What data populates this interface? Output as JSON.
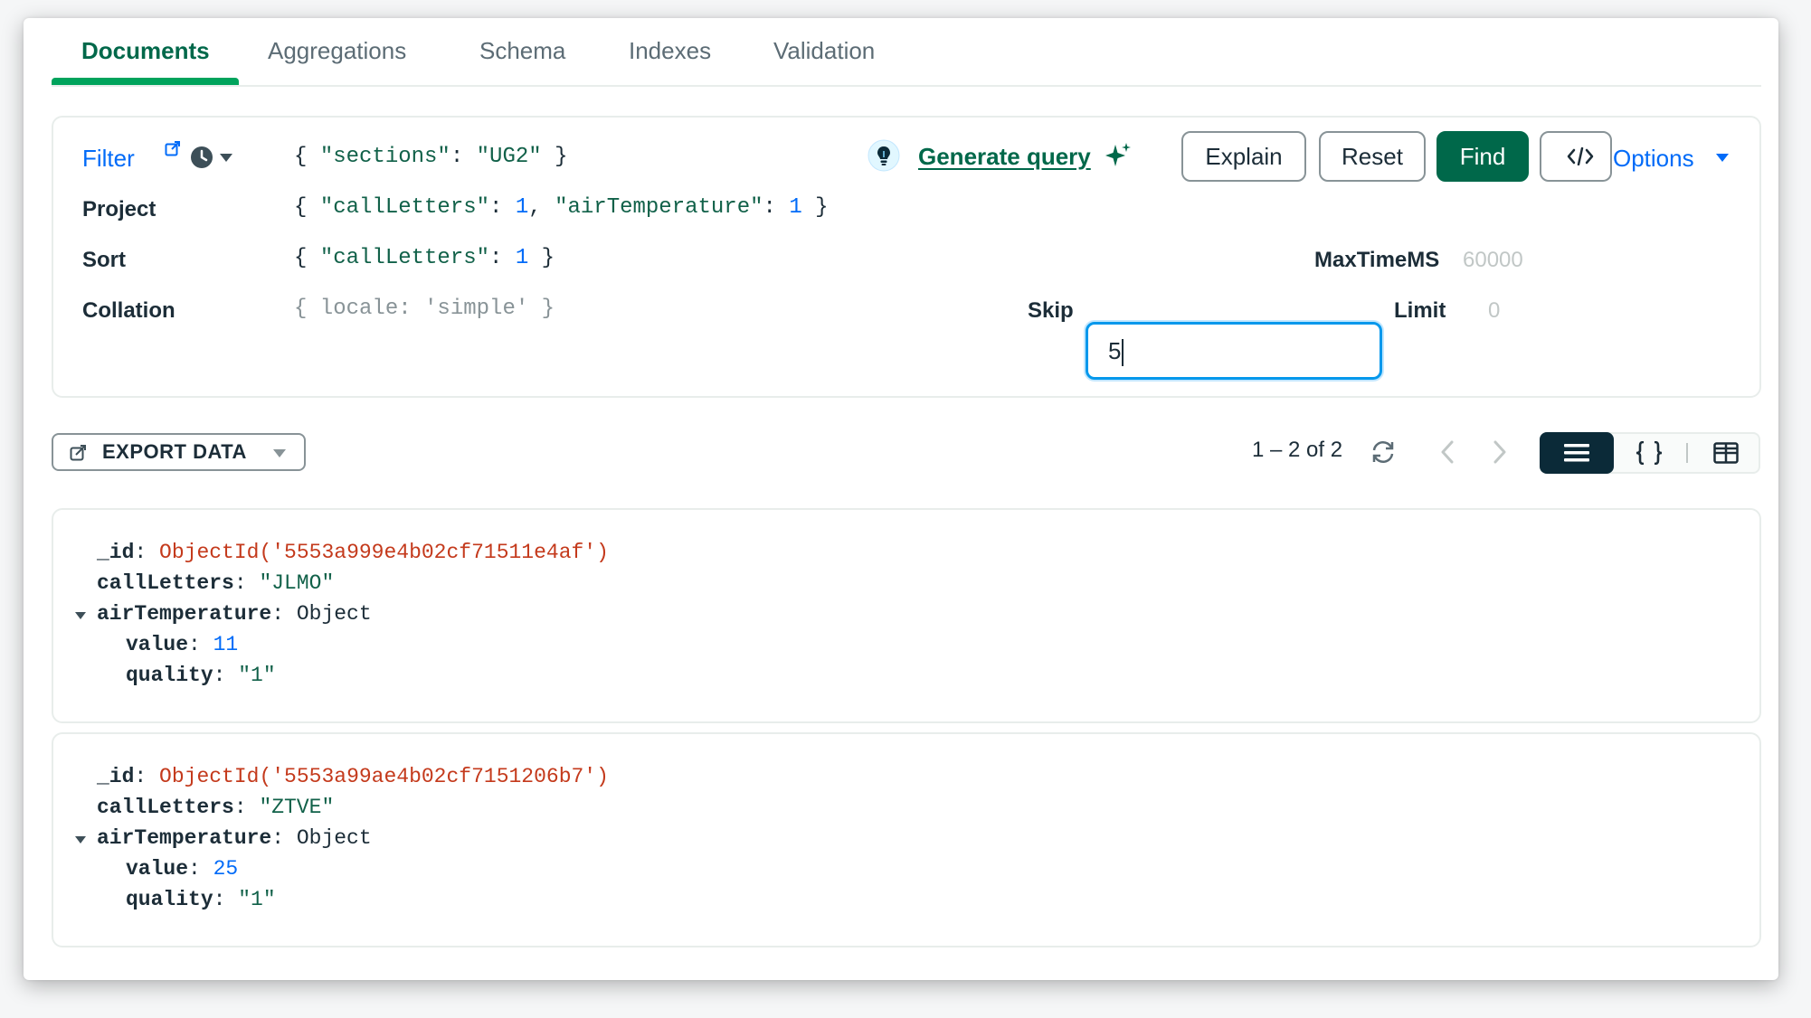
{
  "tabs": [
    {
      "label": "Documents",
      "active": true
    },
    {
      "label": "Aggregations",
      "active": false
    },
    {
      "label": "Schema",
      "active": false
    },
    {
      "label": "Indexes",
      "active": false
    },
    {
      "label": "Validation",
      "active": false
    }
  ],
  "query": {
    "filter_label": "Filter",
    "filter_prefix": "{ ",
    "filter_key": "\"sections\"",
    "filter_sep": ": ",
    "filter_value": "\"UG2\"",
    "filter_suffix": " }",
    "generate_query_label": "Generate query",
    "explain_label": "Explain",
    "reset_label": "Reset",
    "find_label": "Find",
    "options_label": "Options",
    "project_label": "Project",
    "project_prefix": "{ ",
    "project_key1": "\"callLetters\"",
    "project_sep1": ": ",
    "project_val1": "1",
    "project_comma": ", ",
    "project_key2": "\"airTemperature\"",
    "project_sep2": ": ",
    "project_val2": "1",
    "project_suffix": " }",
    "sort_label": "Sort",
    "sort_prefix": "{ ",
    "sort_key": "\"callLetters\"",
    "sort_sep": ": ",
    "sort_val": "1",
    "sort_suffix": " }",
    "collation_label": "Collation",
    "collation_placeholder": "{ locale: 'simple' }",
    "maxtime_label": "MaxTimeMS",
    "maxtime_placeholder": "60000",
    "skip_label": "Skip",
    "skip_value": "5",
    "limit_label": "Limit",
    "limit_placeholder": "0"
  },
  "toolbar": {
    "export_label": "EXPORT DATA",
    "paging_text": "1 – 2 of 2"
  },
  "documents": [
    {
      "id_key": "_id",
      "id_value": "ObjectId('5553a999e4b02cf71511e4af')",
      "call_key": "callLetters",
      "call_value": "\"JLMO\"",
      "air_key": "airTemperature",
      "air_type": "Object",
      "value_key": "value",
      "value_value": "11",
      "quality_key": "quality",
      "quality_value": "\"1\""
    },
    {
      "id_key": "_id",
      "id_value": "ObjectId('5553a99ae4b02cf7151206b7')",
      "call_key": "callLetters",
      "call_value": "\"ZTVE\"",
      "air_key": "airTemperature",
      "air_type": "Object",
      "value_key": "value",
      "value_value": "25",
      "quality_key": "quality",
      "quality_value": "\"1\""
    }
  ],
  "colors": {
    "brand_green": "#00684a",
    "tab_accent": "#00a35c",
    "link_blue": "#016bf8",
    "objectid_red": "#c43a1c",
    "focus_blue": "#0498ec"
  }
}
